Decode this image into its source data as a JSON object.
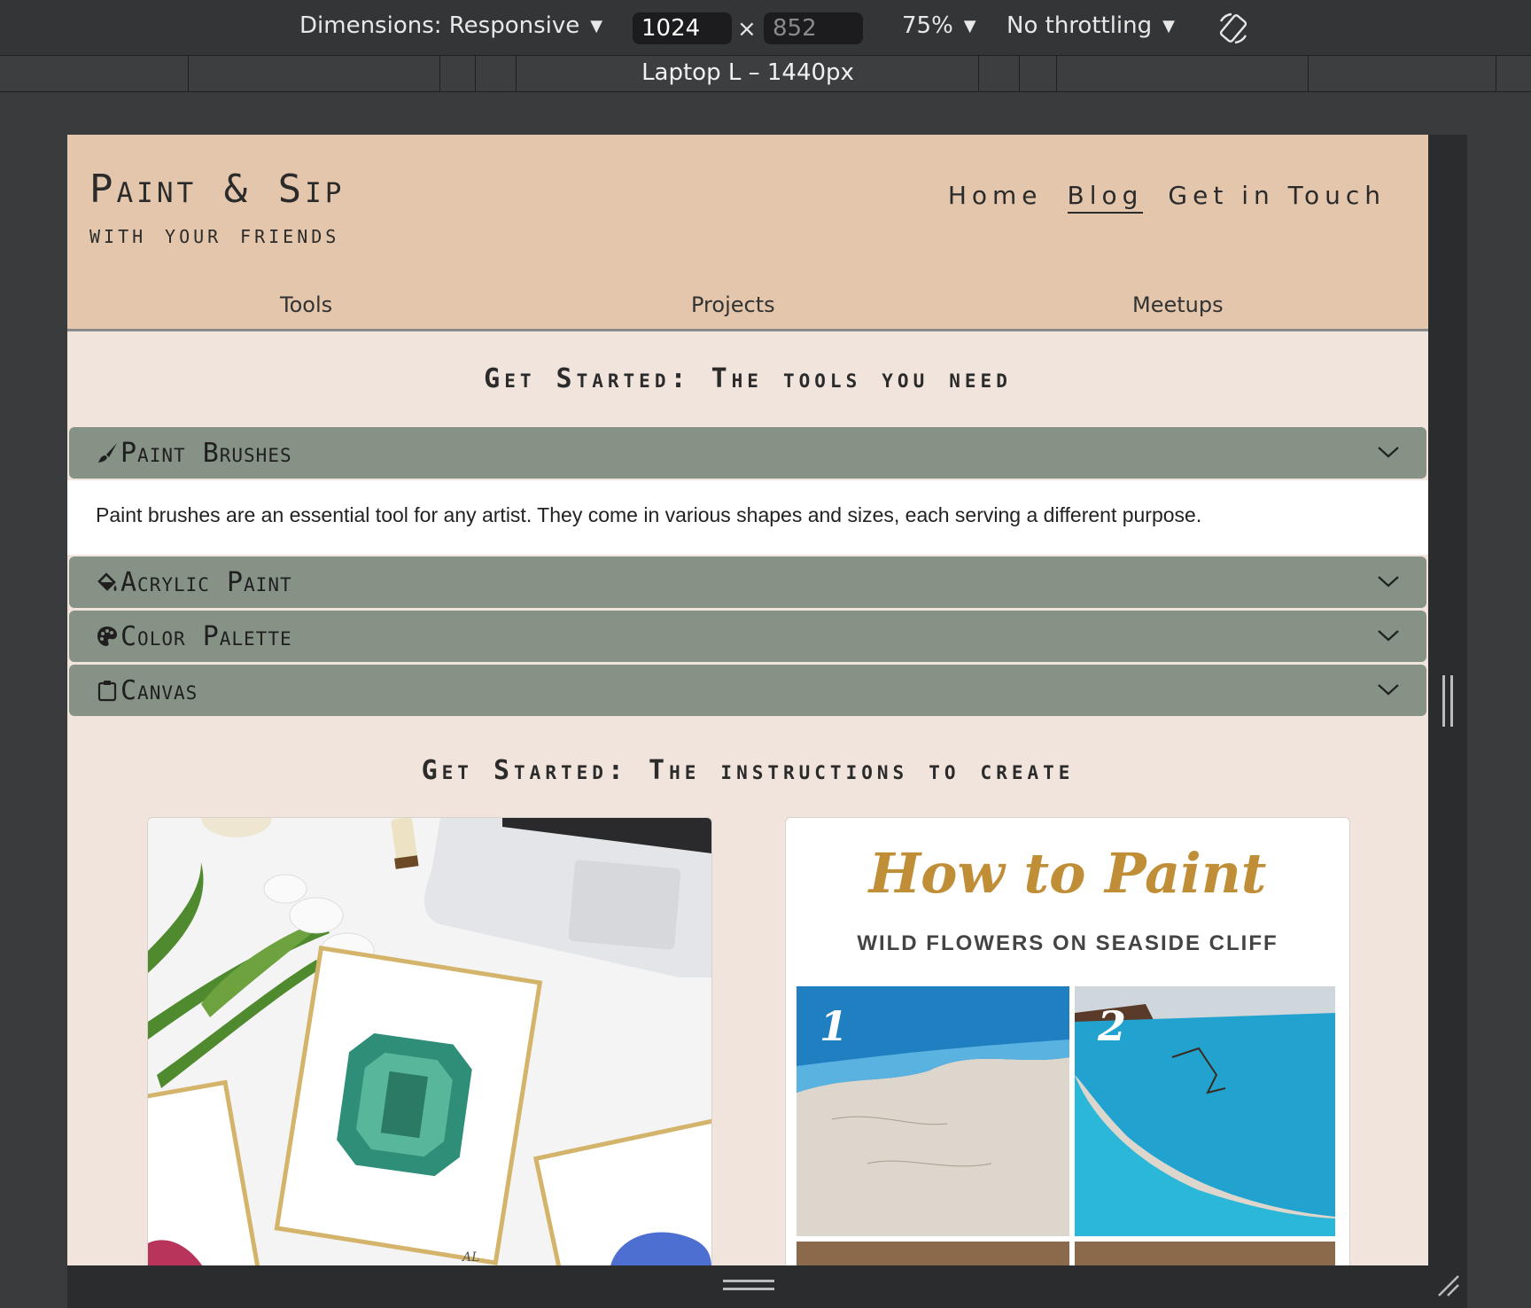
{
  "devtools": {
    "dimensions_label": "Dimensions: Responsive",
    "width_value": "1024",
    "height_value": "852",
    "zoom": "75%",
    "throttling": "No throttling",
    "times": "×",
    "breakpoint_label": "Laptop L – 1440px"
  },
  "site": {
    "title": "Paint & Sip",
    "subtitle": "with your friends",
    "nav": [
      "Home",
      "Blog",
      "Get in Touch"
    ],
    "subnav": [
      "Tools",
      "Projects",
      "Meetups"
    ]
  },
  "tools_section": {
    "heading": "Get Started: The tools you need",
    "items": [
      {
        "title": "Paint Brushes",
        "icon": "paintbrush-icon",
        "expanded": true,
        "body": "Paint brushes are an essential tool for any artist. They come in various shapes and sizes, each serving a different purpose."
      },
      {
        "title": "Acrylic Paint",
        "icon": "paint-bucket-icon",
        "expanded": false
      },
      {
        "title": "Color Palette",
        "icon": "palette-icon",
        "expanded": false
      },
      {
        "title": "Canvas",
        "icon": "clipboard-icon",
        "expanded": false
      }
    ]
  },
  "instructions_section": {
    "heading": "Get Started: The instructions to create",
    "card2": {
      "title": "How to Paint",
      "subtitle": "WILD FLOWERS ON SEASIDE CLIFF",
      "steps": [
        "1",
        "2"
      ]
    }
  },
  "colors": {
    "header_bg": "#e3c6ab",
    "page_bg": "#f1e4dc",
    "accordion_bg": "#869285",
    "title_gold": "#c08e37"
  }
}
